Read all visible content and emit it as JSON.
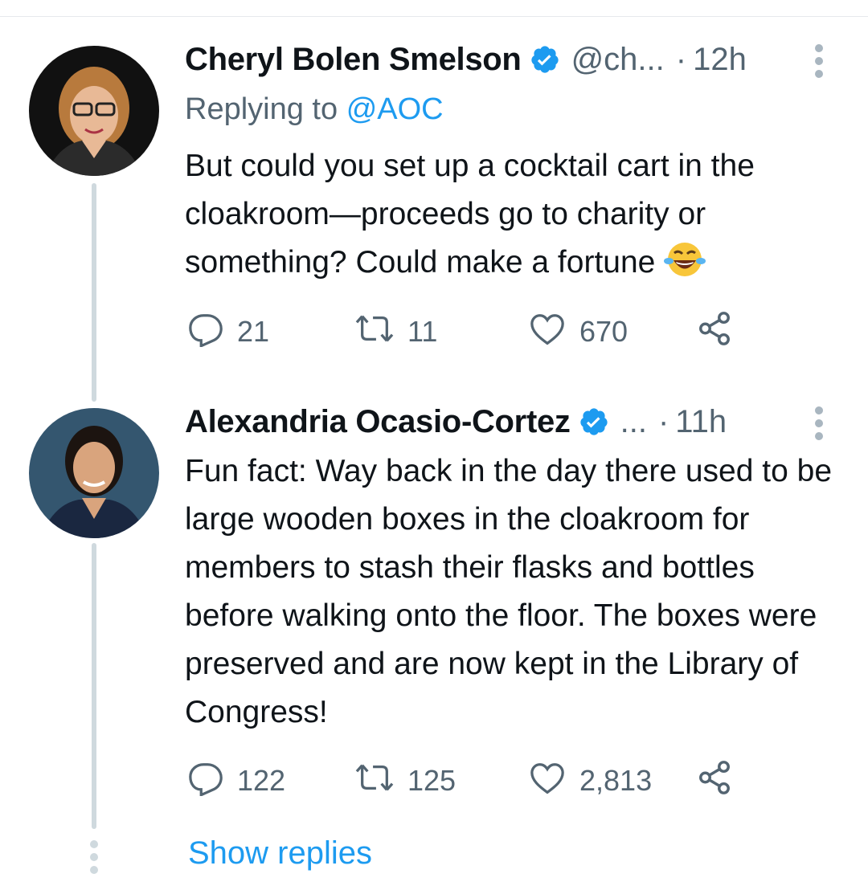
{
  "tweets": [
    {
      "display_name": "Cheryl Bolen Smelson",
      "handle": "@ch...",
      "dot": "·",
      "time": "12h",
      "replying_prefix": "Replying to",
      "replying_to": "@AOC",
      "text": "But could you set up a cocktail cart in the cloakroom—proceeds go to charity or something? Could make a fortune",
      "emoji": "face-with-tears-of-joy-emoji",
      "replies": "21",
      "retweets": "11",
      "likes": "670"
    },
    {
      "display_name": "Alexandria Ocasio-Cortez",
      "handle": "...",
      "dot": "·",
      "time": "11h",
      "text": "Fun fact: Way back in the day there used to be large wooden boxes in the cloakroom for members to stash their flasks and bottles before walking onto the floor. The boxes were preserved and are now kept in the Library of Congress!",
      "replies": "122",
      "retweets": "125",
      "likes": "2,813"
    }
  ],
  "show_replies_label": "Show replies",
  "colors": {
    "accent": "#1d9bf0",
    "secondary_text": "#536471",
    "thread_line": "#cfd9de"
  },
  "icons": [
    "verified-badge-icon",
    "more-options-icon",
    "reply-icon",
    "retweet-icon",
    "like-icon",
    "share-icon"
  ]
}
